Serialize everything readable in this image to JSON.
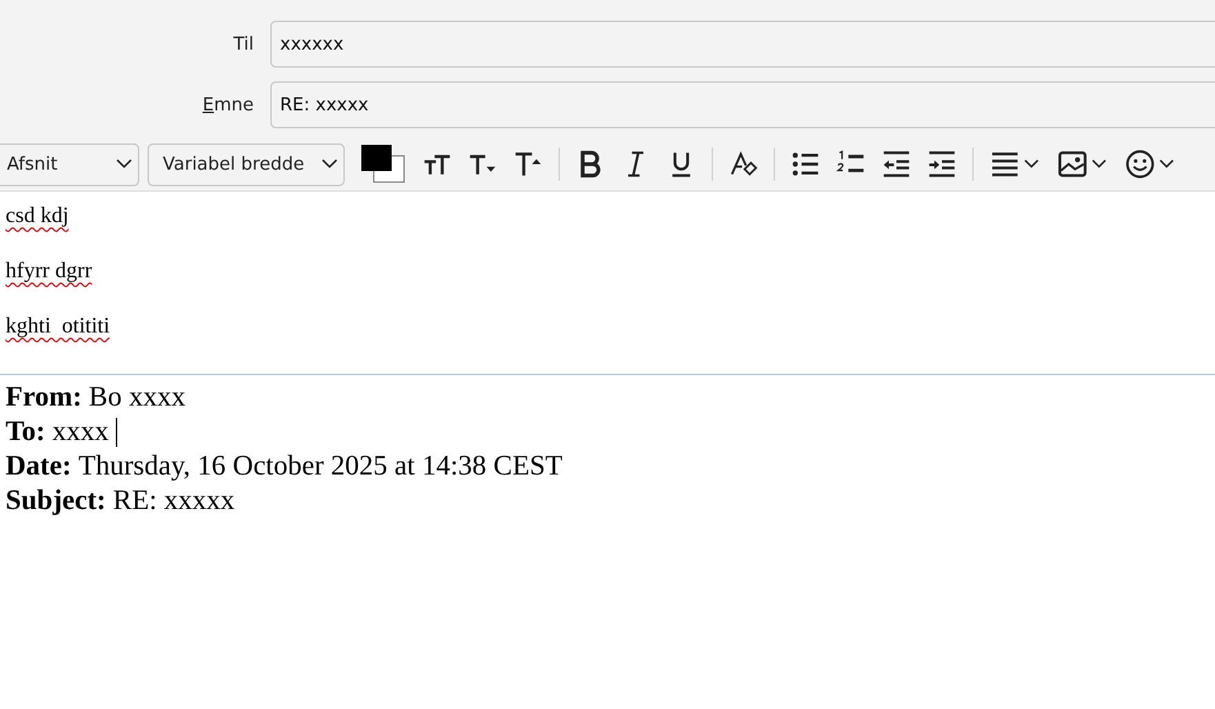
{
  "fields": [
    {
      "label": "Til",
      "value": "xxxxxx",
      "access_key": false
    },
    {
      "label": "Emne",
      "value": "RE: xxxxx",
      "access_key": true
    }
  ],
  "toolbar": {
    "paragraph_format": "Afsnit",
    "font": "Variabel bredde"
  },
  "body": {
    "paragraphs": [
      "csd kdj",
      "hfyrr dgrr",
      "kghti  otititi"
    ],
    "quote_header": [
      {
        "label": "From:",
        "value": "Bo xxxx",
        "cursor": false
      },
      {
        "label": "To:",
        "value": "xxxx",
        "cursor": true
      },
      {
        "label": "Date:",
        "value": "Thursday, 16 October 2025 at 14:38 CEST",
        "cursor": false
      },
      {
        "label": "Subject:",
        "value": "RE: xxxxx",
        "cursor": false
      }
    ]
  }
}
